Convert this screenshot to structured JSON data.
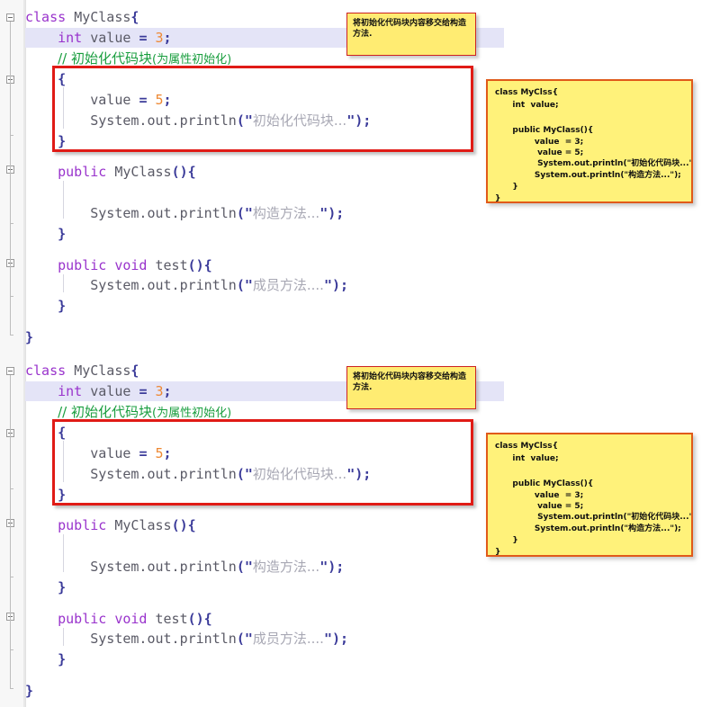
{
  "app": {
    "kind": "java-code-editor-screenshot",
    "background_color": "#ffffff",
    "gutter_color": "#f7f7f7",
    "current_line_highlight_color": "#e4e4f7"
  },
  "palette": {
    "keyword": "#9933cc",
    "identifier": "#5a5a66",
    "number": "#ee8833",
    "operator": "#3a3a99",
    "string": "#a8a8b4",
    "comment": "#1a9e3f",
    "annotation_red": "#e01b16",
    "note_yellow": "#ffec72",
    "callout_yellow": "#fff27a",
    "callout_border": "#e05a1a"
  },
  "editor": {
    "lines": [
      {
        "n": 1,
        "indent": 0,
        "tokens": [
          {
            "t": "class",
            "c": "kw"
          },
          {
            "t": " ",
            "c": "id"
          },
          {
            "t": "MyClass",
            "c": "cls"
          },
          {
            "t": "{",
            "c": "brace"
          }
        ]
      },
      {
        "n": 2,
        "indent": 0,
        "tokens": [
          {
            "t": "    ",
            "c": "id"
          },
          {
            "t": "int",
            "c": "kw"
          },
          {
            "t": " value ",
            "c": "id"
          },
          {
            "t": "=",
            "c": "op"
          },
          {
            "t": " ",
            "c": "id"
          },
          {
            "t": "3",
            "c": "num"
          },
          {
            "t": ";",
            "c": "op"
          }
        ]
      },
      {
        "n": 3,
        "indent": 0,
        "tokens": [
          {
            "t": "    ",
            "c": "id"
          },
          {
            "t": "// 初始化代码块",
            "c": "cmt"
          },
          {
            "t": "(为属性初始化)",
            "c": "cmt-s"
          }
        ]
      },
      {
        "n": 4,
        "indent": 0,
        "tokens": [
          {
            "t": "    ",
            "c": "id"
          },
          {
            "t": "{",
            "c": "brace"
          }
        ]
      },
      {
        "n": 5,
        "indent": 0,
        "tokens": [
          {
            "t": "        value ",
            "c": "id"
          },
          {
            "t": "=",
            "c": "op"
          },
          {
            "t": " ",
            "c": "id"
          },
          {
            "t": "5",
            "c": "num"
          },
          {
            "t": ";",
            "c": "op"
          }
        ]
      },
      {
        "n": 6,
        "indent": 0,
        "tokens": [
          {
            "t": "        System.out.println",
            "c": "id"
          },
          {
            "t": "(\"",
            "c": "quote"
          },
          {
            "t": "初始化代码块...",
            "c": "str"
          },
          {
            "t": "\")",
            "c": "quote"
          },
          {
            "t": ";",
            "c": "op"
          }
        ]
      },
      {
        "n": 7,
        "indent": 0,
        "tokens": [
          {
            "t": "    ",
            "c": "id"
          },
          {
            "t": "}",
            "c": "brace"
          }
        ]
      },
      {
        "n": 8,
        "indent": 0,
        "tokens": []
      },
      {
        "n": 9,
        "indent": 0,
        "tokens": [
          {
            "t": "    ",
            "c": "id"
          },
          {
            "t": "public",
            "c": "kw"
          },
          {
            "t": " MyClass",
            "c": "cls"
          },
          {
            "t": "(){",
            "c": "brace"
          }
        ]
      },
      {
        "n": 10,
        "indent": 0,
        "tokens": []
      },
      {
        "n": 11,
        "indent": 0,
        "tokens": [
          {
            "t": "        System.out.println",
            "c": "id"
          },
          {
            "t": "(\"",
            "c": "quote"
          },
          {
            "t": "构造方法...",
            "c": "str"
          },
          {
            "t": "\")",
            "c": "quote"
          },
          {
            "t": ";",
            "c": "op"
          }
        ]
      },
      {
        "n": 12,
        "indent": 0,
        "tokens": [
          {
            "t": "    ",
            "c": "id"
          },
          {
            "t": "}",
            "c": "brace"
          }
        ]
      },
      {
        "n": 13,
        "indent": 0,
        "tokens": []
      },
      {
        "n": 14,
        "indent": 0,
        "tokens": [
          {
            "t": "    ",
            "c": "id"
          },
          {
            "t": "public",
            "c": "kw"
          },
          {
            "t": " ",
            "c": "id"
          },
          {
            "t": "void",
            "c": "kw"
          },
          {
            "t": " test",
            "c": "id"
          },
          {
            "t": "(){",
            "c": "brace"
          }
        ]
      },
      {
        "n": 15,
        "indent": 0,
        "tokens": [
          {
            "t": "        System.out.println",
            "c": "id"
          },
          {
            "t": "(\"",
            "c": "quote"
          },
          {
            "t": "成员方法....",
            "c": "str"
          },
          {
            "t": "\")",
            "c": "quote"
          },
          {
            "t": ";",
            "c": "op"
          }
        ]
      },
      {
        "n": 16,
        "indent": 0,
        "tokens": [
          {
            "t": "    ",
            "c": "id"
          },
          {
            "t": "}",
            "c": "brace"
          }
        ]
      },
      {
        "n": 17,
        "indent": 0,
        "tokens": []
      },
      {
        "n": 18,
        "indent": 0,
        "tokens": [
          {
            "t": "}",
            "c": "brace"
          }
        ]
      }
    ],
    "raw_text": "class MyClass{\n    int value = 3;\n    // 初始化代码块(为属性初始化)\n    {\n        value = 5;\n        System.out.println(\"初始化代码块...\");\n    }\n\n    public MyClass(){\n\n        System.out.println(\"构造方法...\");\n    }\n\n    public void test(){\n        System.out.println(\"成员方法....\");\n    }\n\n}",
    "current_line_number": 2,
    "fold_marker_lines": [
      1,
      4,
      9,
      14
    ]
  },
  "annotations": {
    "red_box_label": "initializer-block-highlight",
    "note": {
      "text": "将初始化代码块内容移交给构造方法."
    },
    "callout": {
      "lines": [
        "class MyClss{",
        "   int  value;",
        "",
        "   public MyClass(){",
        "       value  = 3;",
        "        value = 5;",
        "        System.out.println(\"初始化代码块...\");",
        "       System.out.println(\"构造方法...\");",
        "   }",
        "}"
      ]
    }
  }
}
